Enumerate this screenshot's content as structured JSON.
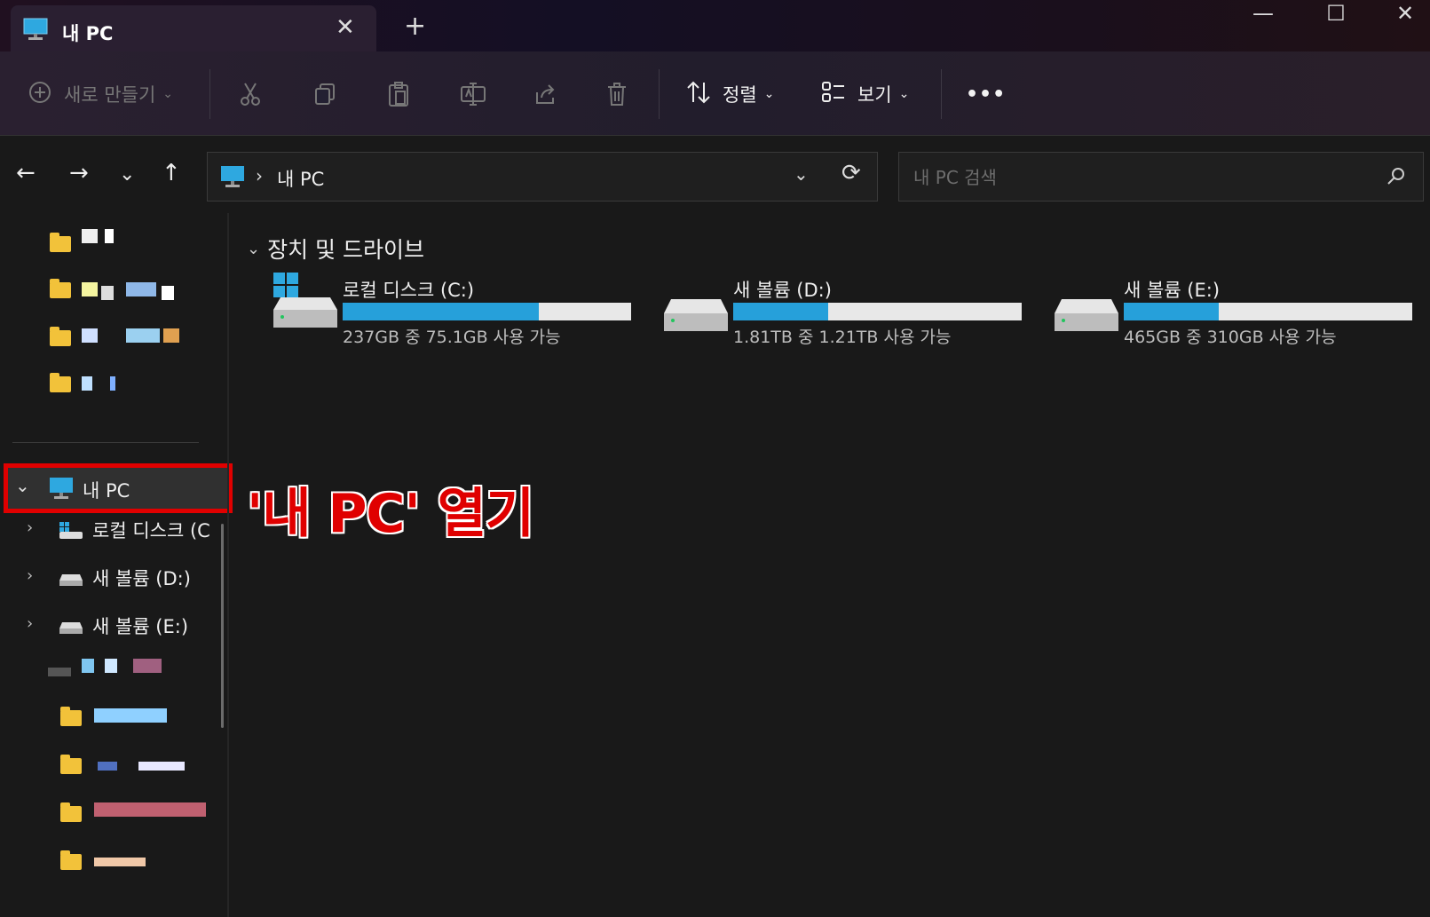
{
  "tab": {
    "title": "내 PC",
    "close_icon": "close-icon",
    "new_tab_icon": "plus-icon"
  },
  "window_controls": [
    "minimize",
    "maximize",
    "close"
  ],
  "commandbar": {
    "new_label": "새로 만들기",
    "sort_label": "정렬",
    "view_label": "보기",
    "more_label": "•••"
  },
  "address": {
    "path": "내 PC"
  },
  "search": {
    "placeholder": "내 PC 검색"
  },
  "sidebar": {
    "this_pc": "내 PC",
    "drives": [
      {
        "label": "로컬 디스크 (C"
      },
      {
        "label": "새 볼륨 (D:)"
      },
      {
        "label": "새 볼륨 (E:)"
      }
    ]
  },
  "content": {
    "section_title": "장치 및 드라이브",
    "drives": [
      {
        "name": "로컬 디스크 (C:)",
        "free_text": "237GB 중 75.1GB 사용 가능",
        "used_fraction": 0.68
      },
      {
        "name": "새 볼륨 (D:)",
        "free_text": "1.81TB 중 1.21TB 사용 가능",
        "used_fraction": 0.33
      },
      {
        "name": "새 볼륨 (E:)",
        "free_text": "465GB 중 310GB 사용 가능",
        "used_fraction": 0.33
      }
    ]
  },
  "annotation": {
    "text": "'내 PC' 열기"
  },
  "colors": {
    "accent": "#26a0da",
    "annotation_red": "#e00000",
    "folder": "#f2c23a"
  }
}
